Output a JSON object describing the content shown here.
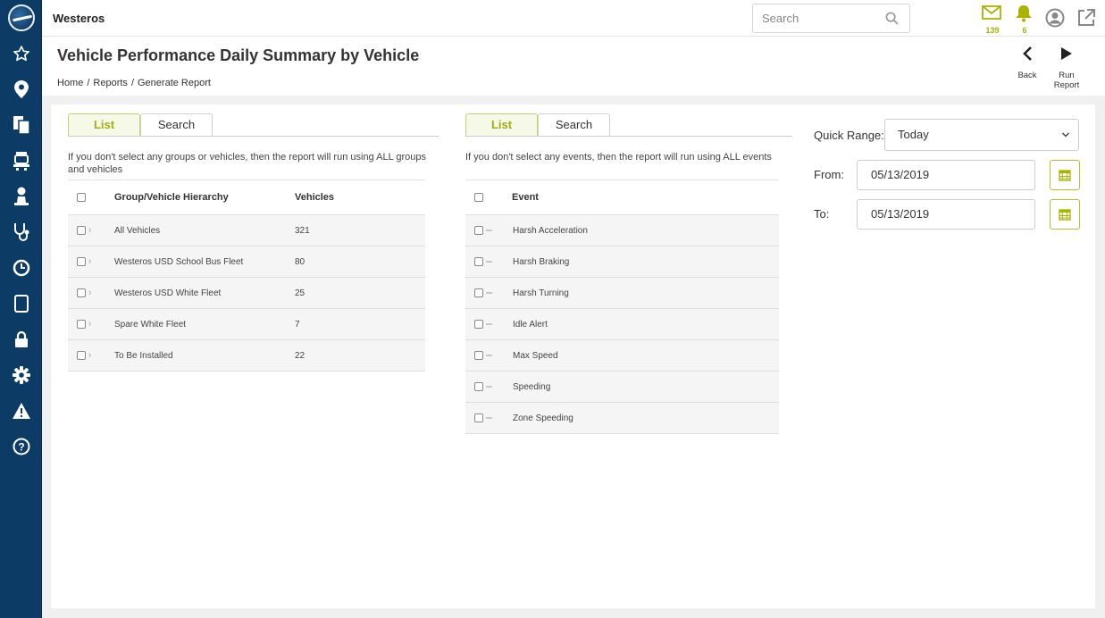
{
  "app": {
    "title": "Westeros"
  },
  "search": {
    "placeholder": "Search"
  },
  "notifications": {
    "messages_count": "139",
    "alerts_count": "6"
  },
  "page": {
    "title": "Vehicle Performance Daily Summary by Vehicle",
    "breadcrumb": [
      "Home",
      "/",
      "Reports",
      "/",
      "Generate Report"
    ],
    "back_label": "Back",
    "run_label": "Run Report"
  },
  "vehicles_panel": {
    "tabs": [
      "List",
      "Search"
    ],
    "note": "If you don't select any groups or vehicles, then the report will run using ALL groups and vehicles",
    "columns": [
      "Group/Vehicle Hierarchy",
      "Vehicles"
    ],
    "rows": [
      {
        "name": "All Vehicles",
        "count": "321"
      },
      {
        "name": "Westeros USD School Bus Fleet",
        "count": "80"
      },
      {
        "name": "Westeros USD White Fleet",
        "count": "25"
      },
      {
        "name": "Spare White Fleet",
        "count": "7"
      },
      {
        "name": "To Be Installed",
        "count": "22"
      }
    ]
  },
  "events_panel": {
    "tabs": [
      "List",
      "Search"
    ],
    "note": "If you don't select any events, then the report will run using ALL events",
    "columns": [
      "Event"
    ],
    "rows": [
      "Harsh Acceleration",
      "Harsh Braking",
      "Harsh Turning",
      "Idle Alert",
      "Max Speed",
      "Speeding",
      "Zone Speeding"
    ]
  },
  "range": {
    "quick_label": "Quick Range:",
    "quick_value": "Today",
    "from_label": "From:",
    "from_value": "05/13/2019",
    "to_label": "To:",
    "to_value": "05/13/2019"
  },
  "colors": {
    "sidebar": "#0c3b66",
    "accent": "#a8b400"
  }
}
